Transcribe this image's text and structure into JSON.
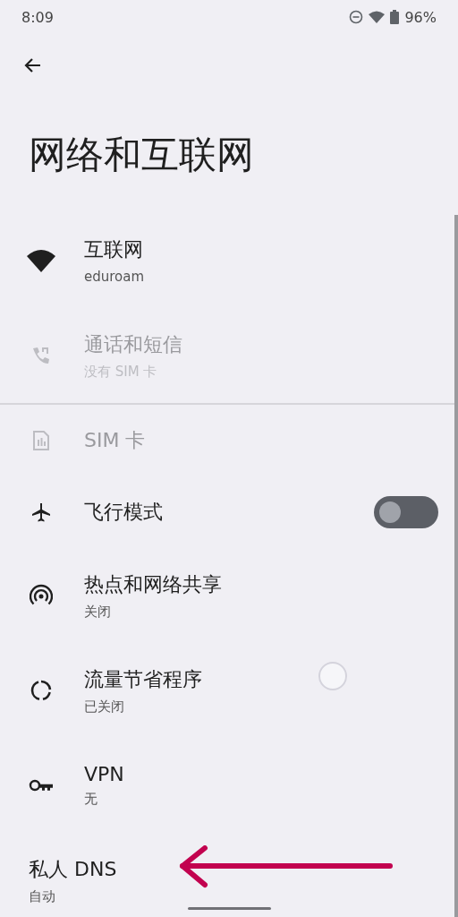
{
  "status_bar": {
    "time": "8:09",
    "battery": "96%"
  },
  "page": {
    "title": "网络和互联网"
  },
  "items": [
    {
      "kind": "link",
      "title": "互联网",
      "subtitle": "eduroam",
      "disabled": false
    },
    {
      "kind": "link",
      "title": "通话和短信",
      "subtitle": "没有 SIM 卡",
      "disabled": true
    },
    {
      "kind": "divider"
    },
    {
      "kind": "link",
      "title": "SIM 卡",
      "disabled": true
    },
    {
      "kind": "toggle",
      "title": "飞行模式",
      "disabled": false,
      "on": false
    },
    {
      "kind": "link",
      "title": "热点和网络共享",
      "subtitle": "关闭",
      "disabled": false
    },
    {
      "kind": "link",
      "title": "流量节省程序",
      "subtitle": "已关闭",
      "disabled": false
    },
    {
      "kind": "link",
      "title": "VPN",
      "subtitle": "无",
      "disabled": false
    },
    {
      "kind": "link",
      "title": "私人 DNS",
      "subtitle": "自动",
      "disabled": false,
      "no_icon": true
    }
  ]
}
